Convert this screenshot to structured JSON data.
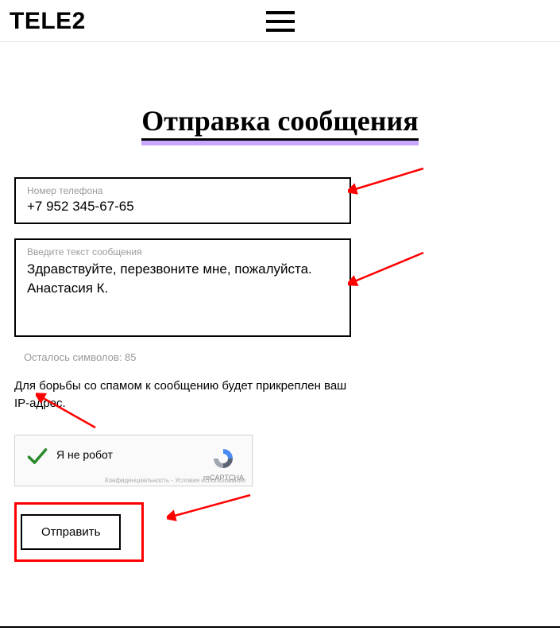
{
  "header": {
    "logo": "TELE2"
  },
  "page": {
    "title": "Отправка сообщения"
  },
  "form": {
    "phone_label": "Номер телефона",
    "phone_value": "+7 952 345-67-65",
    "message_label": "Введите текст сообщения",
    "message_value": "Здравствуйте, перезвоните мне, пожалуйста. Анастасия К.",
    "chars_left": "Осталось символов: 85",
    "notice": "Для борьбы со спамом к сообщению будет прикреплен ваш IP-адрес.",
    "recaptcha": {
      "label": "Я не робот",
      "brand": "reCAPTCHA",
      "terms": "Конфиденциальность - Условия использования"
    },
    "submit": "Отправить"
  }
}
